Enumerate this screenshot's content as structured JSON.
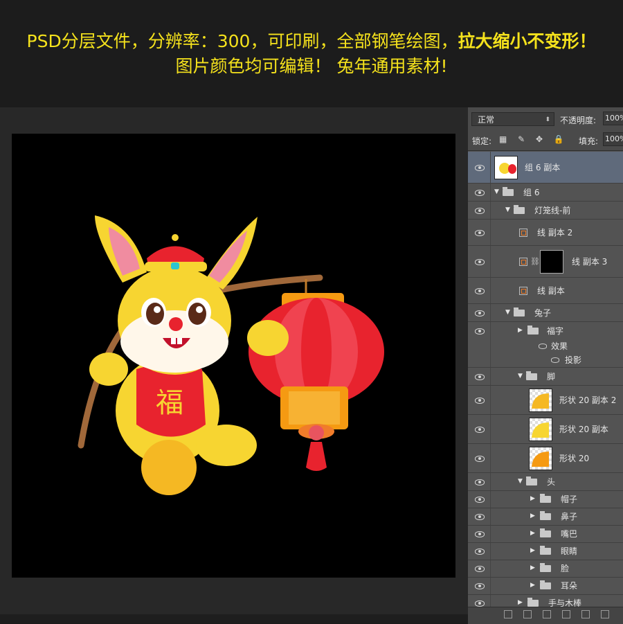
{
  "banner": {
    "line1_normal": "PSD分层文件，分辨率：300，可印刷，全部钢笔绘图，",
    "line1_bold": "拉大缩小不变形！",
    "line2": "图片颜色均可编辑！ 兔年通用素材!"
  },
  "artwork": {
    "badge_char": "福"
  },
  "panel": {
    "blend_mode": "正常",
    "opacity_label": "不透明度:",
    "opacity_value": "100%",
    "lock_label": "锁定:",
    "fill_label": "填充:",
    "fill_value": "100%",
    "layers": [
      {
        "label": "组 6 副本",
        "kind": "layer-thumb",
        "selected": true
      },
      {
        "label": "组 6",
        "kind": "group-open"
      },
      {
        "label": "灯笼线-前",
        "kind": "group-open"
      },
      {
        "label": "线 副本 2",
        "kind": "shape"
      },
      {
        "label": "线 副本 3",
        "kind": "shape-mask"
      },
      {
        "label": "线 副本",
        "kind": "shape"
      },
      {
        "label": "兔子",
        "kind": "group-open"
      },
      {
        "label": "福字",
        "kind": "group-closed"
      },
      {
        "label": "效果",
        "kind": "effect"
      },
      {
        "label": "投影",
        "kind": "effect"
      },
      {
        "label": "脚",
        "kind": "group-open"
      },
      {
        "label": "形状 20 副本 2",
        "kind": "shape-thumb"
      },
      {
        "label": "形状 20 副本",
        "kind": "shape-thumb"
      },
      {
        "label": "形状 20",
        "kind": "shape-thumb"
      },
      {
        "label": "头",
        "kind": "group-open"
      },
      {
        "label": "帽子",
        "kind": "group-closed"
      },
      {
        "label": "鼻子",
        "kind": "group-closed"
      },
      {
        "label": "嘴巴",
        "kind": "group-closed"
      },
      {
        "label": "眼睛",
        "kind": "group-closed"
      },
      {
        "label": "脸",
        "kind": "group-closed"
      },
      {
        "label": "耳朵",
        "kind": "group-closed"
      },
      {
        "label": "手与木棒",
        "kind": "group-closed"
      }
    ]
  },
  "colors": {
    "banner_text": "#f5e21c",
    "selected_layer": "#5f6a7b",
    "rabbit_yellow": "#f7d531",
    "lantern_red": "#e8232e",
    "lantern_orange": "#f59a12"
  }
}
